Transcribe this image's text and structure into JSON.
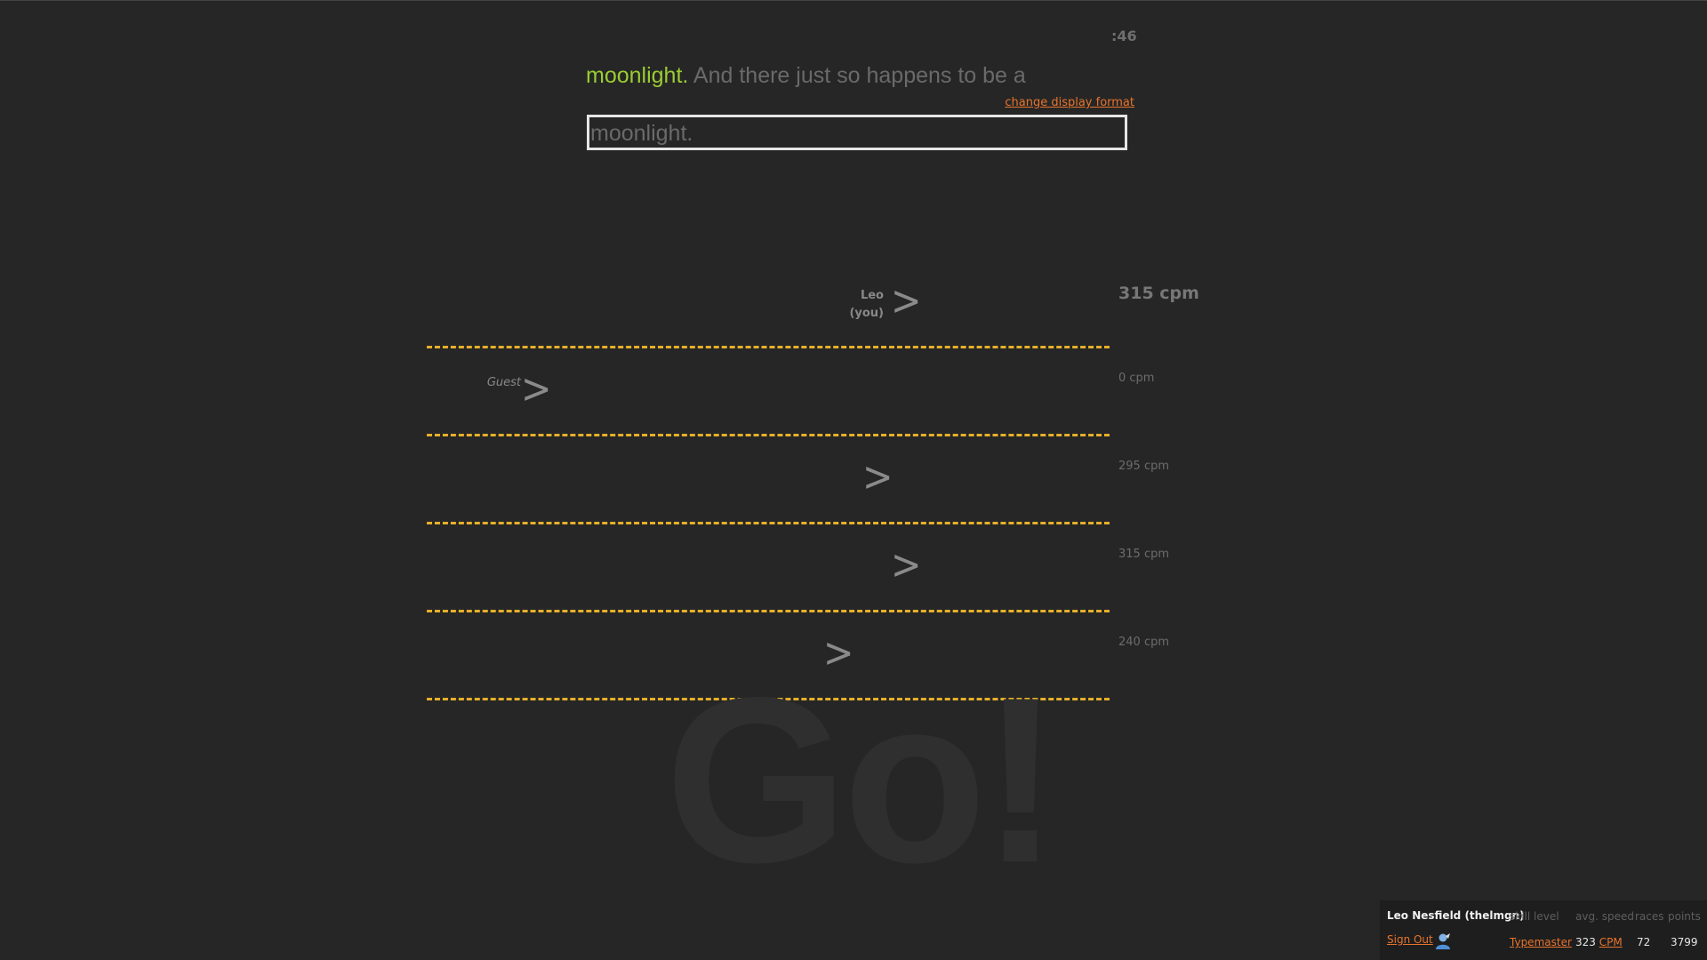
{
  "timer": ":46",
  "passage": {
    "typed": "moonlight.",
    "remaining": " And there just so happens to be a"
  },
  "change_display_format": "change display format",
  "input": {
    "value": "moonlight."
  },
  "race": {
    "racers": [
      {
        "name_line1": "Leo",
        "name_line2": "(you)",
        "speed": "315 cpm",
        "is_you": true,
        "progress": 0.7
      },
      {
        "name_line1": "Guest",
        "name_line2": "",
        "speed": "0 cpm",
        "is_you": false,
        "progress": 0.14
      },
      {
        "name_line1": "",
        "name_line2": "",
        "speed": "295 cpm",
        "is_you": false,
        "progress": 0.66
      },
      {
        "name_line1": "",
        "name_line2": "",
        "speed": "315 cpm",
        "is_you": false,
        "progress": 0.7
      },
      {
        "name_line1": "",
        "name_line2": "",
        "speed": "240 cpm",
        "is_you": false,
        "progress": 0.6
      }
    ],
    "arrow_glyph": ">",
    "lane_color": "#e6b02a"
  },
  "go_text": "Go!",
  "account": {
    "name": "Leo Nesfield (thelmgn)",
    "headers": {
      "skill_level": "skill level",
      "avg_speed": "avg. speed",
      "races": "races",
      "points": "points"
    },
    "sign_out": "Sign Out",
    "user_icon": "user-avatar-icon",
    "skill_level": "Typemaster",
    "avg_speed_value": "323",
    "avg_speed_unit": "CPM",
    "races": "72",
    "points": "3799"
  },
  "colors": {
    "background": "#262626",
    "accent": "#e8742c",
    "typed_text": "#9acd32"
  }
}
